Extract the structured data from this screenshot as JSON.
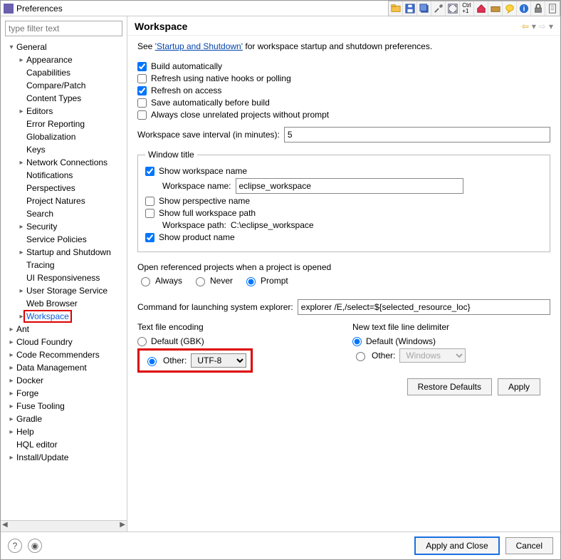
{
  "title": "Preferences",
  "filter_placeholder": "type filter text",
  "tree": [
    {
      "label": "General",
      "depth": 0,
      "arrow": "open"
    },
    {
      "label": "Appearance",
      "depth": 1,
      "arrow": "closed"
    },
    {
      "label": "Capabilities",
      "depth": 1,
      "arrow": "none"
    },
    {
      "label": "Compare/Patch",
      "depth": 1,
      "arrow": "none"
    },
    {
      "label": "Content Types",
      "depth": 1,
      "arrow": "none"
    },
    {
      "label": "Editors",
      "depth": 1,
      "arrow": "closed"
    },
    {
      "label": "Error Reporting",
      "depth": 1,
      "arrow": "none"
    },
    {
      "label": "Globalization",
      "depth": 1,
      "arrow": "none"
    },
    {
      "label": "Keys",
      "depth": 1,
      "arrow": "none"
    },
    {
      "label": "Network Connections",
      "depth": 1,
      "arrow": "closed"
    },
    {
      "label": "Notifications",
      "depth": 1,
      "arrow": "none"
    },
    {
      "label": "Perspectives",
      "depth": 1,
      "arrow": "none"
    },
    {
      "label": "Project Natures",
      "depth": 1,
      "arrow": "none"
    },
    {
      "label": "Search",
      "depth": 1,
      "arrow": "none"
    },
    {
      "label": "Security",
      "depth": 1,
      "arrow": "closed"
    },
    {
      "label": "Service Policies",
      "depth": 1,
      "arrow": "none"
    },
    {
      "label": "Startup and Shutdown",
      "depth": 1,
      "arrow": "closed"
    },
    {
      "label": "Tracing",
      "depth": 1,
      "arrow": "none"
    },
    {
      "label": "UI Responsiveness",
      "depth": 1,
      "arrow": "none"
    },
    {
      "label": "User Storage Service",
      "depth": 1,
      "arrow": "closed"
    },
    {
      "label": "Web Browser",
      "depth": 1,
      "arrow": "none"
    },
    {
      "label": "Workspace",
      "depth": 1,
      "arrow": "closed",
      "selected": true,
      "highlight": true
    },
    {
      "label": "Ant",
      "depth": 0,
      "arrow": "closed"
    },
    {
      "label": "Cloud Foundry",
      "depth": 0,
      "arrow": "closed"
    },
    {
      "label": "Code Recommenders",
      "depth": 0,
      "arrow": "closed"
    },
    {
      "label": "Data Management",
      "depth": 0,
      "arrow": "closed"
    },
    {
      "label": "Docker",
      "depth": 0,
      "arrow": "closed"
    },
    {
      "label": "Forge",
      "depth": 0,
      "arrow": "closed"
    },
    {
      "label": "Fuse Tooling",
      "depth": 0,
      "arrow": "closed"
    },
    {
      "label": "Gradle",
      "depth": 0,
      "arrow": "closed"
    },
    {
      "label": "Help",
      "depth": 0,
      "arrow": "closed"
    },
    {
      "label": "HQL editor",
      "depth": 0,
      "arrow": "none"
    },
    {
      "label": "Install/Update",
      "depth": 0,
      "arrow": "closed"
    }
  ],
  "page": {
    "heading": "Workspace",
    "desc_prefix": "See ",
    "desc_link": "'Startup and Shutdown'",
    "desc_suffix": " for workspace startup and shutdown preferences.",
    "checks": [
      {
        "label": "Build automatically",
        "checked": true
      },
      {
        "label": "Refresh using native hooks or polling",
        "checked": false
      },
      {
        "label": "Refresh on access",
        "checked": true
      },
      {
        "label": "Save automatically before build",
        "checked": false
      },
      {
        "label": "Always close unrelated projects without prompt",
        "checked": false
      }
    ],
    "save_interval_label": "Workspace save interval (in minutes):",
    "save_interval_value": "5",
    "window_title_legend": "Window title",
    "window_title": {
      "show_workspace_name": {
        "label": "Show workspace name",
        "checked": true
      },
      "workspace_name_label": "Workspace name:",
      "workspace_name_value": "eclipse_workspace",
      "show_perspective": {
        "label": "Show perspective name",
        "checked": false
      },
      "show_full_path": {
        "label": "Show full workspace path",
        "checked": false
      },
      "workspace_path_label": "Workspace path:",
      "workspace_path_value": "C:\\eclipse_workspace",
      "show_product": {
        "label": "Show product name",
        "checked": true
      }
    },
    "open_ref_label": "Open referenced projects when a project is opened",
    "open_ref_options": {
      "always": "Always",
      "never": "Never",
      "prompt": "Prompt"
    },
    "open_ref_selected": "prompt",
    "explorer_label": "Command for launching system explorer:",
    "explorer_value": "explorer /E,/select=${selected_resource_loc}",
    "encoding": {
      "heading": "Text file encoding",
      "default_label": "Default (GBK)",
      "other_label": "Other:",
      "other_value": "UTF-8",
      "selected": "other"
    },
    "delimiter": {
      "heading": "New text file line delimiter",
      "default_label": "Default (Windows)",
      "other_label": "Other:",
      "other_value": "Windows",
      "selected": "default"
    },
    "buttons": {
      "restore": "Restore Defaults",
      "apply": "Apply",
      "apply_close": "Apply and Close",
      "cancel": "Cancel"
    }
  }
}
